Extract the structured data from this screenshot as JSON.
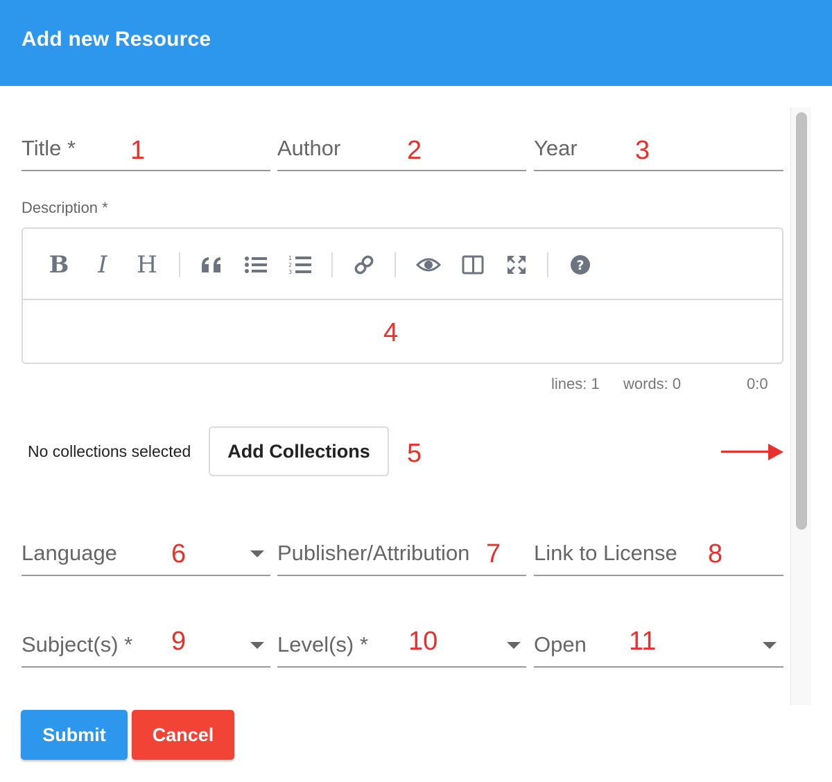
{
  "dialog": {
    "title": "Add new Resource"
  },
  "fields": {
    "title": {
      "label": "Title *",
      "annotation": "1"
    },
    "author": {
      "label": "Author",
      "annotation": "2"
    },
    "year": {
      "label": "Year",
      "annotation": "3"
    },
    "description": {
      "label": "Description *",
      "annotation": "4"
    },
    "collections": {
      "annotation": "5"
    },
    "language": {
      "label": "Language",
      "annotation": "6"
    },
    "publisher": {
      "label": "Publisher/Attribution",
      "annotation": "7"
    },
    "license": {
      "label": "Link to License",
      "annotation": "8"
    },
    "subjects": {
      "label": "Subject(s) *",
      "annotation": "9"
    },
    "levels": {
      "label": "Level(s) *",
      "annotation": "10"
    },
    "open": {
      "value": "Open",
      "annotation": "11"
    }
  },
  "editor": {
    "toolbar": [
      "bold-icon",
      "italic-icon",
      "heading-icon",
      "quote-icon",
      "bullet-list-icon",
      "numbered-list-icon",
      "link-icon",
      "preview-icon",
      "side-by-side-icon",
      "fullscreen-icon",
      "help-icon"
    ],
    "status": {
      "lines": "lines: 1",
      "words": "words: 0",
      "cursor": "0:0"
    }
  },
  "collections": {
    "status": "No collections selected",
    "add_button": "Add Collections"
  },
  "actions": {
    "submit": "Submit",
    "cancel": "Cancel"
  },
  "colors": {
    "header": "#2d97ee",
    "submit": "#2d97ee",
    "cancel": "#f14437",
    "annotation": "#e8302c"
  }
}
